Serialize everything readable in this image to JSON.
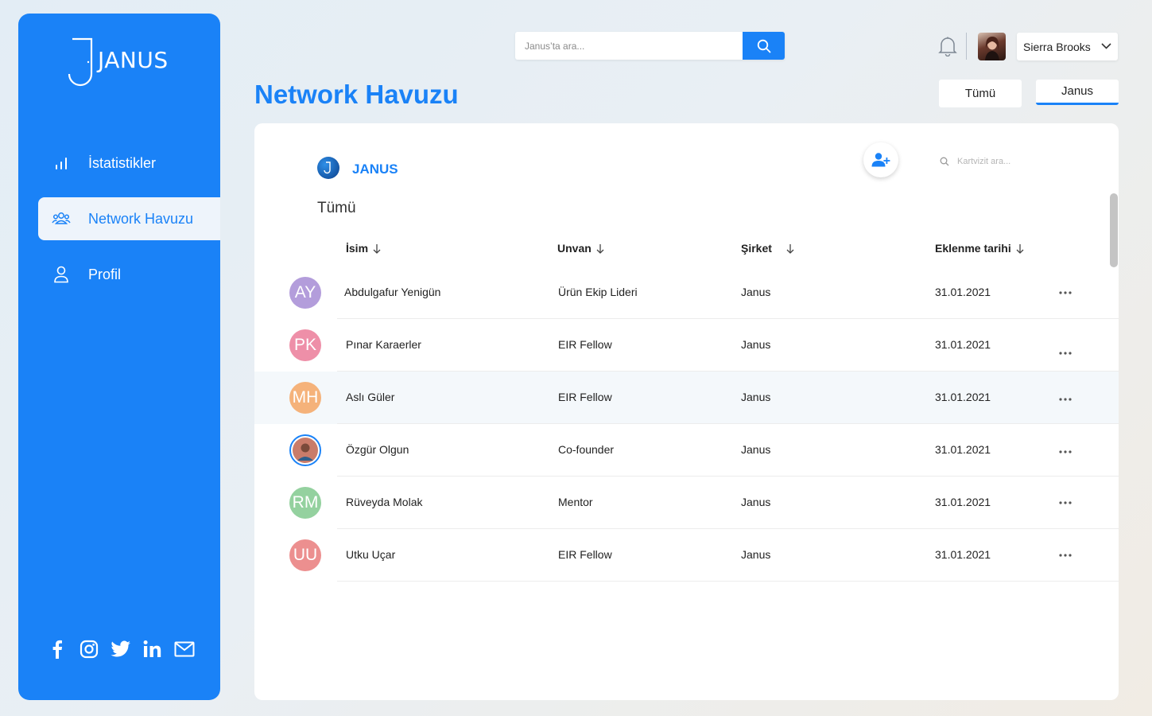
{
  "brand": {
    "name": "JANUS"
  },
  "sidebar": {
    "items": [
      {
        "label": "İstatistikler",
        "icon": "bar-chart-icon",
        "active": false
      },
      {
        "label": "Network Havuzu",
        "icon": "users-icon",
        "active": true
      },
      {
        "label": "Profil",
        "icon": "user-icon",
        "active": false
      }
    ],
    "social": [
      "facebook-icon",
      "instagram-icon",
      "twitter-icon",
      "linkedin-icon",
      "mail-icon"
    ]
  },
  "search": {
    "placeholder": "Janus’ta ara..."
  },
  "user": {
    "name": "Sierra Brooks"
  },
  "page": {
    "title": "Network Havuzu"
  },
  "filters": [
    {
      "label": "Tümü",
      "active": false
    },
    {
      "label": "Janus",
      "active": true
    }
  ],
  "card": {
    "org_name": "JANUS",
    "search_placeholder": "Kartvizit ara...",
    "section_title": "Tümü",
    "columns": [
      "İsim",
      "Unvan",
      "Şirket",
      "Eklenme tarihi"
    ],
    "rows": [
      {
        "initials": "AY",
        "color": "#b39ddb",
        "name": "Abdulgafur Yenigün",
        "title": "Ürün Ekip Lideri",
        "company": "Janus",
        "date": "31.01.2021"
      },
      {
        "initials": "PK",
        "color": "#ee8fa8",
        "name": "Pınar Karaerler",
        "title": "EIR Fellow",
        "company": "Janus",
        "date": "31.01.2021"
      },
      {
        "initials": "MH",
        "color": "#f5b27a",
        "name": "Aslı Güler",
        "title": "EIR Fellow",
        "company": "Janus",
        "date": "31.01.2021"
      },
      {
        "initials": "",
        "color": "#c97c6a",
        "name": "Özgür Olgun",
        "title": "Co-founder",
        "company": "Janus",
        "date": "31.01.2021"
      },
      {
        "initials": "RM",
        "color": "#94d19f",
        "name": "Rüveyda Molak",
        "title": "Mentor",
        "company": "Janus",
        "date": "31.01.2021"
      },
      {
        "initials": "UU",
        "color": "#ec8f8f",
        "name": "Utku Uçar",
        "title": "EIR Fellow",
        "company": "Janus",
        "date": "31.01.2021"
      }
    ]
  },
  "colors": {
    "accent": "#1a82f7",
    "highlight_row": "#f4f8fb"
  }
}
